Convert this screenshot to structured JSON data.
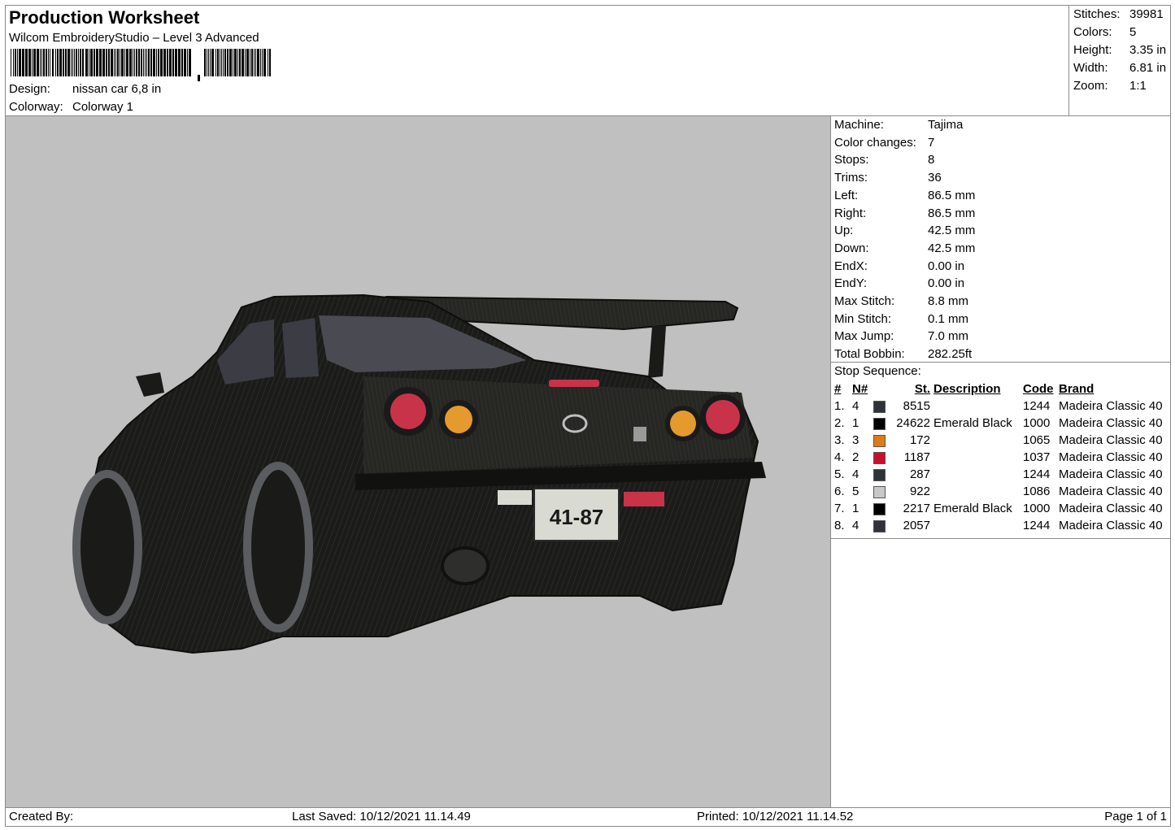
{
  "header": {
    "title": "Production Worksheet",
    "software": "Wilcom EmbroideryStudio – Level 3 Advanced",
    "barcode_icon": "barcode-icon",
    "design_label": "Design:",
    "design_value": "nissan car 6,8 in",
    "colorway_label": "Colorway:",
    "colorway_value": "Colorway 1"
  },
  "summary": {
    "stitches_label": "Stitches:",
    "stitches": "39981",
    "colors_label": "Colors:",
    "colors": "5",
    "height_label": "Height:",
    "height": "3.35 in",
    "width_label": "Width:",
    "width": "6.81 in",
    "zoom_label": "Zoom:",
    "zoom": "1:1"
  },
  "preview": {
    "plate_text": "41-87",
    "image_icon": "embroidery-car-image"
  },
  "machine": {
    "rows": [
      {
        "label": "Machine:",
        "value": "Tajima"
      },
      {
        "label": "Color changes:",
        "value": "7"
      },
      {
        "label": "Stops:",
        "value": "8"
      },
      {
        "label": "Trims:",
        "value": "36"
      },
      {
        "label": "Left:",
        "value": "86.5 mm"
      },
      {
        "label": "Right:",
        "value": "86.5 mm"
      },
      {
        "label": "Up:",
        "value": "42.5 mm"
      },
      {
        "label": "Down:",
        "value": "42.5 mm"
      },
      {
        "label": "EndX:",
        "value": "0.00 in"
      },
      {
        "label": "EndY:",
        "value": "0.00 in"
      },
      {
        "label": "Max Stitch:",
        "value": "8.8 mm"
      },
      {
        "label": "Min Stitch:",
        "value": "0.1 mm"
      },
      {
        "label": "Max Jump:",
        "value": "7.0 mm"
      },
      {
        "label": "Total Bobbin:",
        "value": "282.25ft"
      }
    ]
  },
  "stops": {
    "title": "Stop Sequence:",
    "headers": {
      "hash": "#",
      "n": "N#",
      "st": "St.",
      "desc": "Description",
      "code": "Code",
      "brand": "Brand"
    },
    "rows": [
      {
        "idx": "1.",
        "n": "4",
        "color": "#30323a",
        "st": "8515",
        "desc": "",
        "code": "1244",
        "brand": "Madeira Classic 40"
      },
      {
        "idx": "2.",
        "n": "1",
        "color": "#000000",
        "st": "24622",
        "desc": "Emerald Black",
        "code": "1000",
        "brand": "Madeira Classic 40"
      },
      {
        "idx": "3.",
        "n": "3",
        "color": "#e07b1a",
        "st": "172",
        "desc": "",
        "code": "1065",
        "brand": "Madeira Classic 40"
      },
      {
        "idx": "4.",
        "n": "2",
        "color": "#c8102e",
        "st": "1187",
        "desc": "",
        "code": "1037",
        "brand": "Madeira Classic 40"
      },
      {
        "idx": "5.",
        "n": "4",
        "color": "#30323a",
        "st": "287",
        "desc": "",
        "code": "1244",
        "brand": "Madeira Classic 40"
      },
      {
        "idx": "6.",
        "n": "5",
        "color": "#c8c8c8",
        "st": "922",
        "desc": "",
        "code": "1086",
        "brand": "Madeira Classic 40"
      },
      {
        "idx": "7.",
        "n": "1",
        "color": "#000000",
        "st": "2217",
        "desc": "Emerald Black",
        "code": "1000",
        "brand": "Madeira Classic 40"
      },
      {
        "idx": "8.",
        "n": "4",
        "color": "#30323a",
        "st": "2057",
        "desc": "",
        "code": "1244",
        "brand": "Madeira Classic 40"
      }
    ]
  },
  "footer": {
    "created_by": "Created By:",
    "last_saved": "Last Saved: 10/12/2021 11.14.49",
    "printed": "Printed: 10/12/2021 11.14.52",
    "page": "Page 1 of 1"
  }
}
